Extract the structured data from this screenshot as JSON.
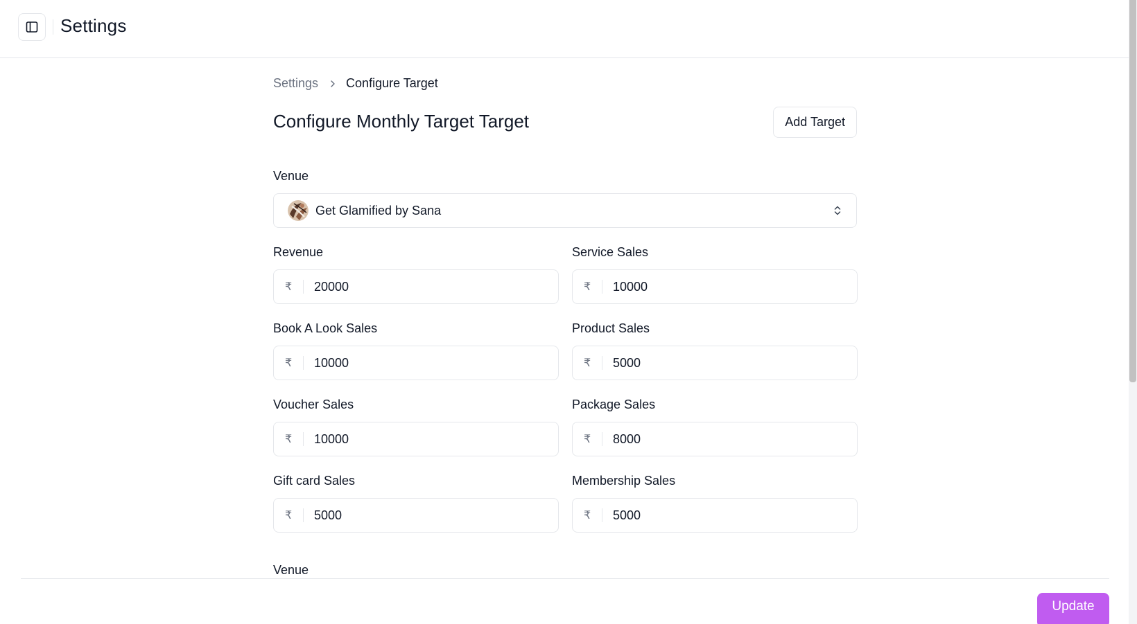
{
  "header": {
    "title": "Settings"
  },
  "breadcrumb": {
    "parent": "Settings",
    "current": "Configure Target"
  },
  "page": {
    "title": "Configure Monthly Target Target",
    "add_target_label": "Add Target"
  },
  "venue": {
    "label": "Venue",
    "selected": "Get Glamified by Sana"
  },
  "currency_symbol": "₹",
  "fields": [
    {
      "label": "Revenue",
      "value": "20000"
    },
    {
      "label": "Service Sales",
      "value": "10000"
    },
    {
      "label": "Book A Look Sales",
      "value": "10000"
    },
    {
      "label": "Product Sales",
      "value": "5000"
    },
    {
      "label": "Voucher Sales",
      "value": "10000"
    },
    {
      "label": "Package Sales",
      "value": "8000"
    },
    {
      "label": "Gift card Sales",
      "value": "5000"
    },
    {
      "label": "Membership Sales",
      "value": "5000"
    }
  ],
  "next_section": {
    "label": "Venue"
  },
  "footer": {
    "update_label": "Update"
  },
  "colors": {
    "accent": "#c05cf0",
    "border": "#e5e7eb",
    "muted_text": "#6b7280",
    "text": "#111827"
  }
}
